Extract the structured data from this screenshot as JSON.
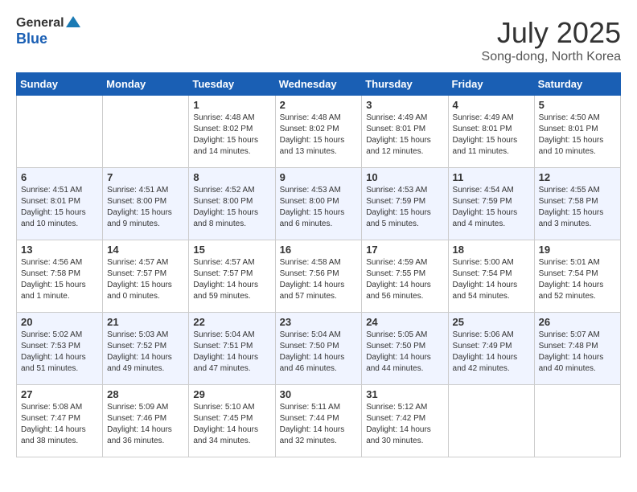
{
  "logo": {
    "general": "General",
    "blue": "Blue"
  },
  "title": {
    "month": "July 2025",
    "location": "Song-dong, North Korea"
  },
  "weekdays": [
    "Sunday",
    "Monday",
    "Tuesday",
    "Wednesday",
    "Thursday",
    "Friday",
    "Saturday"
  ],
  "weeks": [
    [
      {
        "day": "",
        "info": ""
      },
      {
        "day": "",
        "info": ""
      },
      {
        "day": "1",
        "info": "Sunrise: 4:48 AM\nSunset: 8:02 PM\nDaylight: 15 hours\nand 14 minutes."
      },
      {
        "day": "2",
        "info": "Sunrise: 4:48 AM\nSunset: 8:02 PM\nDaylight: 15 hours\nand 13 minutes."
      },
      {
        "day": "3",
        "info": "Sunrise: 4:49 AM\nSunset: 8:01 PM\nDaylight: 15 hours\nand 12 minutes."
      },
      {
        "day": "4",
        "info": "Sunrise: 4:49 AM\nSunset: 8:01 PM\nDaylight: 15 hours\nand 11 minutes."
      },
      {
        "day": "5",
        "info": "Sunrise: 4:50 AM\nSunset: 8:01 PM\nDaylight: 15 hours\nand 10 minutes."
      }
    ],
    [
      {
        "day": "6",
        "info": "Sunrise: 4:51 AM\nSunset: 8:01 PM\nDaylight: 15 hours\nand 10 minutes."
      },
      {
        "day": "7",
        "info": "Sunrise: 4:51 AM\nSunset: 8:00 PM\nDaylight: 15 hours\nand 9 minutes."
      },
      {
        "day": "8",
        "info": "Sunrise: 4:52 AM\nSunset: 8:00 PM\nDaylight: 15 hours\nand 8 minutes."
      },
      {
        "day": "9",
        "info": "Sunrise: 4:53 AM\nSunset: 8:00 PM\nDaylight: 15 hours\nand 6 minutes."
      },
      {
        "day": "10",
        "info": "Sunrise: 4:53 AM\nSunset: 7:59 PM\nDaylight: 15 hours\nand 5 minutes."
      },
      {
        "day": "11",
        "info": "Sunrise: 4:54 AM\nSunset: 7:59 PM\nDaylight: 15 hours\nand 4 minutes."
      },
      {
        "day": "12",
        "info": "Sunrise: 4:55 AM\nSunset: 7:58 PM\nDaylight: 15 hours\nand 3 minutes."
      }
    ],
    [
      {
        "day": "13",
        "info": "Sunrise: 4:56 AM\nSunset: 7:58 PM\nDaylight: 15 hours\nand 1 minute."
      },
      {
        "day": "14",
        "info": "Sunrise: 4:57 AM\nSunset: 7:57 PM\nDaylight: 15 hours\nand 0 minutes."
      },
      {
        "day": "15",
        "info": "Sunrise: 4:57 AM\nSunset: 7:57 PM\nDaylight: 14 hours\nand 59 minutes."
      },
      {
        "day": "16",
        "info": "Sunrise: 4:58 AM\nSunset: 7:56 PM\nDaylight: 14 hours\nand 57 minutes."
      },
      {
        "day": "17",
        "info": "Sunrise: 4:59 AM\nSunset: 7:55 PM\nDaylight: 14 hours\nand 56 minutes."
      },
      {
        "day": "18",
        "info": "Sunrise: 5:00 AM\nSunset: 7:54 PM\nDaylight: 14 hours\nand 54 minutes."
      },
      {
        "day": "19",
        "info": "Sunrise: 5:01 AM\nSunset: 7:54 PM\nDaylight: 14 hours\nand 52 minutes."
      }
    ],
    [
      {
        "day": "20",
        "info": "Sunrise: 5:02 AM\nSunset: 7:53 PM\nDaylight: 14 hours\nand 51 minutes."
      },
      {
        "day": "21",
        "info": "Sunrise: 5:03 AM\nSunset: 7:52 PM\nDaylight: 14 hours\nand 49 minutes."
      },
      {
        "day": "22",
        "info": "Sunrise: 5:04 AM\nSunset: 7:51 PM\nDaylight: 14 hours\nand 47 minutes."
      },
      {
        "day": "23",
        "info": "Sunrise: 5:04 AM\nSunset: 7:50 PM\nDaylight: 14 hours\nand 46 minutes."
      },
      {
        "day": "24",
        "info": "Sunrise: 5:05 AM\nSunset: 7:50 PM\nDaylight: 14 hours\nand 44 minutes."
      },
      {
        "day": "25",
        "info": "Sunrise: 5:06 AM\nSunset: 7:49 PM\nDaylight: 14 hours\nand 42 minutes."
      },
      {
        "day": "26",
        "info": "Sunrise: 5:07 AM\nSunset: 7:48 PM\nDaylight: 14 hours\nand 40 minutes."
      }
    ],
    [
      {
        "day": "27",
        "info": "Sunrise: 5:08 AM\nSunset: 7:47 PM\nDaylight: 14 hours\nand 38 minutes."
      },
      {
        "day": "28",
        "info": "Sunrise: 5:09 AM\nSunset: 7:46 PM\nDaylight: 14 hours\nand 36 minutes."
      },
      {
        "day": "29",
        "info": "Sunrise: 5:10 AM\nSunset: 7:45 PM\nDaylight: 14 hours\nand 34 minutes."
      },
      {
        "day": "30",
        "info": "Sunrise: 5:11 AM\nSunset: 7:44 PM\nDaylight: 14 hours\nand 32 minutes."
      },
      {
        "day": "31",
        "info": "Sunrise: 5:12 AM\nSunset: 7:42 PM\nDaylight: 14 hours\nand 30 minutes."
      },
      {
        "day": "",
        "info": ""
      },
      {
        "day": "",
        "info": ""
      }
    ]
  ]
}
